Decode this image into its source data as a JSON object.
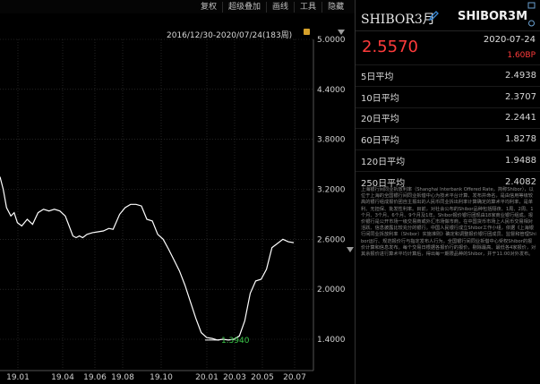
{
  "toolbar": {
    "items": [
      "复权",
      "超级叠加",
      "画线",
      "工具",
      "隐藏"
    ]
  },
  "chart": {
    "range_label": "2016/12/30-2020/07/24(183周)",
    "min_label": "1.3940"
  },
  "side_panel": {
    "name": "SHIBOR3月",
    "code": "SHIBOR3M",
    "price": "2.5570",
    "date": "2020-07-24",
    "change": "1.60BP",
    "stats": [
      {
        "label": "5日平均",
        "value": "2.4938"
      },
      {
        "label": "10日平均",
        "value": "2.3707"
      },
      {
        "label": "20日平均",
        "value": "2.2441"
      },
      {
        "label": "60日平均",
        "value": "1.8278"
      },
      {
        "label": "120日平均",
        "value": "1.9488"
      },
      {
        "label": "250日平均",
        "value": "2.4082"
      }
    ],
    "description": "上海银行间同业拆放利率（Shanghai Interbank Offered Rate，简称Shibor），以位于上海的全国银行间同业拆借中心为技术平台计算、发布并命名，是由信用等级较高的银行组成报价团自主报出的人民币同业拆出利率计算确定的算术平均利率，是单利、无担保、批发性利率。目前，对社会公布的Shibor品种包括隔夜、1周、2周、1个月、3个月、6个月、9个月及1年。Shibor报价银行团现由18家商业银行组成。报价银行是公开市场一级交易商或外汇市场做市商，在中国货币市场上人民币交易相对活跃、信息披露比较充分的银行。中国人民银行成立Shibor工作小组，依据《上海银行间同业拆放利率（Shibor）实施准则》确定和调整报价银行团成员、监督和管理Shibor运行、规范报价行与指定发布人行为。全国银行间同业拆借中心受权Shibor的报价计算和信息发布。每个交易日根据各报价行的报价，剔除最高、最低各4家报价，对其余报价进行算术平均计算后，得出每一期限品种的Shibor，并于11:00对外发布。"
  },
  "chart_data": {
    "type": "line",
    "y_ticks": [
      "5.0000",
      "4.4000",
      "3.8000",
      "3.2000",
      "2.6000",
      "2.0000",
      "1.4000"
    ],
    "x_ticks": [
      "19.01",
      "19.04",
      "19.06",
      "19.08",
      "19.10",
      "20.01",
      "20.03",
      "20.05",
      "20.07"
    ],
    "ylim": [
      1.4,
      5.0
    ],
    "grid": true,
    "x": [
      0,
      0.3,
      0.6,
      1.0,
      1.3,
      1.6,
      2.0,
      2.5,
      3.0,
      3.5,
      4.0,
      4.5,
      5.0,
      5.5,
      6.0,
      6.3,
      6.7,
      7.0,
      7.3,
      7.6,
      8.0,
      8.5,
      9.0,
      9.5,
      10.0,
      10.4,
      11.0,
      11.5,
      12.0,
      12.5,
      13.0,
      13.5,
      14.0,
      14.5,
      15.0,
      15.5,
      16.0,
      16.5,
      17.0,
      17.5,
      18.0,
      18.5,
      19.0,
      19.5,
      20.0,
      20.5,
      21.0,
      21.5,
      22.0,
      22.5,
      23.0,
      23.5,
      24.0,
      24.5,
      25.0,
      25.5,
      26.0,
      26.5,
      27.0
    ],
    "values": [
      3.35,
      3.2,
      2.98,
      2.88,
      2.92,
      2.8,
      2.76,
      2.84,
      2.78,
      2.92,
      2.96,
      2.94,
      2.96,
      2.94,
      2.88,
      2.78,
      2.64,
      2.62,
      2.64,
      2.62,
      2.66,
      2.68,
      2.69,
      2.7,
      2.73,
      2.72,
      2.9,
      2.98,
      3.02,
      3.02,
      3.0,
      2.84,
      2.82,
      2.66,
      2.6,
      2.48,
      2.35,
      2.22,
      2.05,
      1.85,
      1.65,
      1.48,
      1.42,
      1.41,
      1.39,
      1.4,
      1.39,
      1.4,
      1.44,
      1.62,
      1.95,
      2.1,
      2.12,
      2.24,
      2.5,
      2.55,
      2.6,
      2.57,
      2.56
    ]
  },
  "colors": {
    "price_up": "#ff3b3b",
    "min_label": "#3cc84a",
    "line": "#ffffff"
  }
}
